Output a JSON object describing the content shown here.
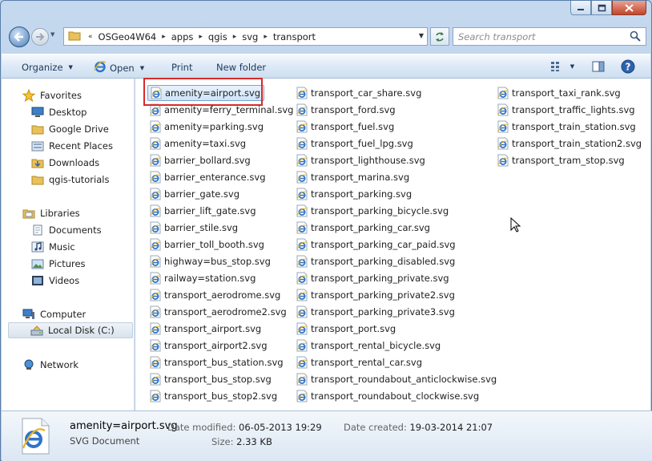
{
  "window": {
    "breadcrumb": [
      "OSGeo4W64",
      "apps",
      "qgis",
      "svg",
      "transport"
    ],
    "breadcrumb_overflow": "«",
    "search_placeholder": "Search transport"
  },
  "toolbar": {
    "organize_label": "Organize",
    "open_label": "Open",
    "print_label": "Print",
    "new_folder_label": "New folder"
  },
  "nav": {
    "favorites_label": "Favorites",
    "favorites": [
      "Desktop",
      "Google Drive",
      "Recent Places",
      "Downloads",
      "qgis-tutorials"
    ],
    "libraries_label": "Libraries",
    "libraries": [
      "Documents",
      "Music",
      "Pictures",
      "Videos"
    ],
    "computer_label": "Computer",
    "computer": [
      "Local Disk (C:)"
    ],
    "network_label": "Network"
  },
  "files": {
    "column1": [
      "amenity=airport.svg",
      "amenity=ferry_terminal.svg",
      "amenity=parking.svg",
      "amenity=taxi.svg",
      "barrier_bollard.svg",
      "barrier_enterance.svg",
      "barrier_gate.svg",
      "barrier_lift_gate.svg",
      "barrier_stile.svg",
      "barrier_toll_booth.svg",
      "highway=bus_stop.svg",
      "railway=station.svg",
      "transport_aerodrome.svg",
      "transport_aerodrome2.svg",
      "transport_airport.svg",
      "transport_airport2.svg",
      "transport_bus_station.svg",
      "transport_bus_stop.svg",
      "transport_bus_stop2.svg"
    ],
    "column2": [
      "transport_car_share.svg",
      "transport_ford.svg",
      "transport_fuel.svg",
      "transport_fuel_lpg.svg",
      "transport_lighthouse.svg",
      "transport_marina.svg",
      "transport_parking.svg",
      "transport_parking_bicycle.svg",
      "transport_parking_car.svg",
      "transport_parking_car_paid.svg",
      "transport_parking_disabled.svg",
      "transport_parking_private.svg",
      "transport_parking_private2.svg",
      "transport_parking_private3.svg",
      "transport_port.svg",
      "transport_rental_bicycle.svg",
      "transport_rental_car.svg",
      "transport_roundabout_anticlockwise.svg",
      "transport_roundabout_clockwise.svg"
    ],
    "column3": [
      "transport_taxi_rank.svg",
      "transport_traffic_lights.svg",
      "transport_train_station.svg",
      "transport_train_station2.svg",
      "transport_tram_stop.svg"
    ]
  },
  "details": {
    "name": "amenity=airport.svg",
    "type": "SVG Document",
    "modified_label": "Date modified:",
    "modified_value": "06-05-2013 19:29",
    "created_label": "Date created:",
    "created_value": "19-03-2014 21:07",
    "size_label": "Size:",
    "size_value": "2.33 KB"
  },
  "colors": {
    "accent": "#3b72c4",
    "highlight_box": "#d92a2a"
  }
}
